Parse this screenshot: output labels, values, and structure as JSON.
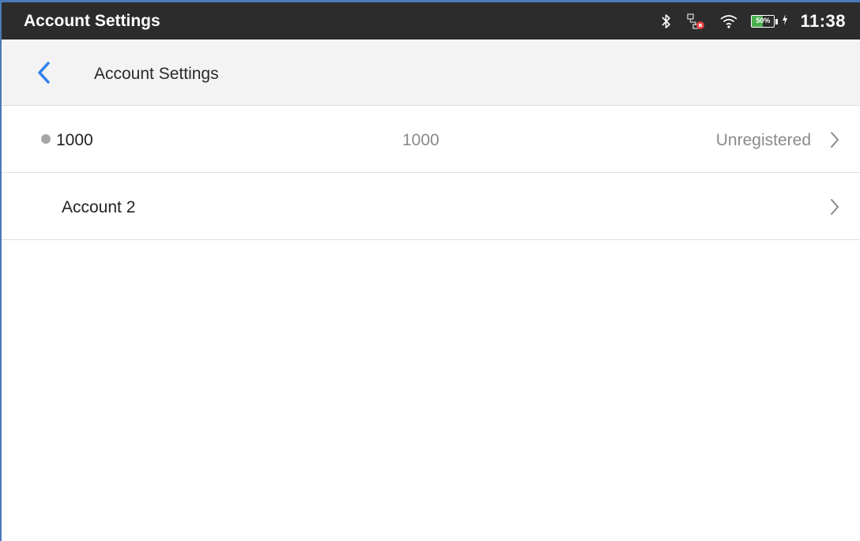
{
  "statusbar": {
    "title": "Account Settings",
    "battery_percent": "50%",
    "battery_level": 0.5,
    "time": "11:38",
    "icons": [
      "bluetooth-icon",
      "network-disconnected-icon",
      "wifi-icon",
      "battery-icon",
      "charging-icon"
    ]
  },
  "appbar": {
    "title": "Account Settings",
    "back_icon": "chevron-left-icon",
    "accent_color": "#2f80ed"
  },
  "accounts": [
    {
      "name": "1000",
      "number": "1000",
      "status": "Unregistered",
      "status_dot": true
    },
    {
      "name": "Account 2",
      "number": "",
      "status": "",
      "status_dot": false
    }
  ],
  "colors": {
    "statusbar_bg": "#2c2c2c",
    "appbar_bg": "#f3f3f3",
    "dot_unregistered": "#a6a6a6",
    "battery_green": "#4caf50",
    "network_error_red": "#e53935"
  }
}
